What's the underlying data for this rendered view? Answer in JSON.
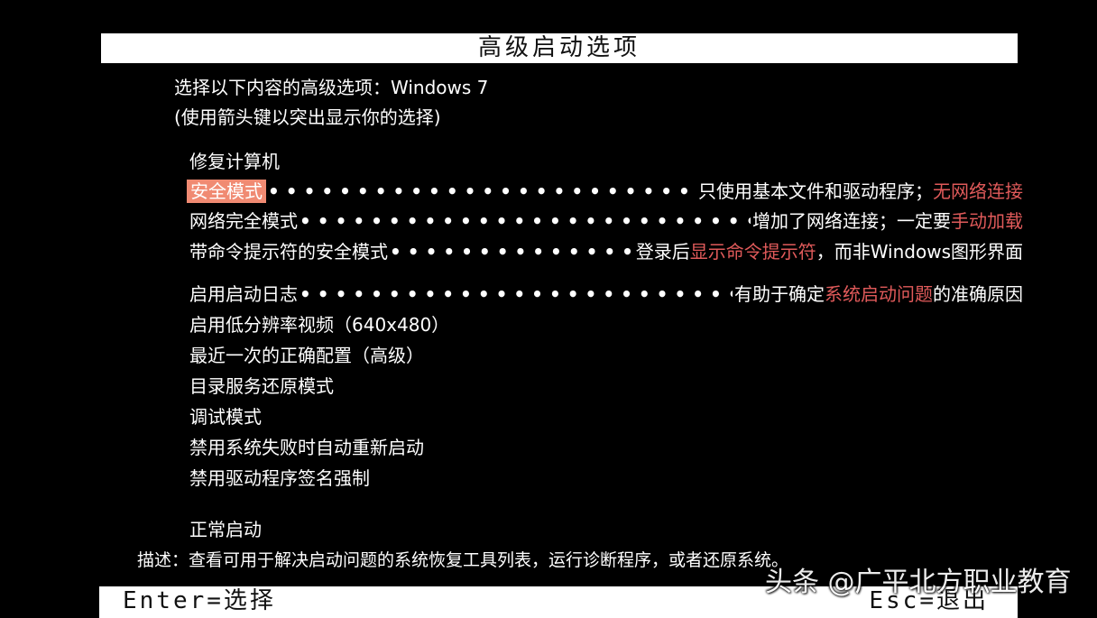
{
  "title": "高级启动选项",
  "prompt": "选择以下内容的高级选项：Windows 7",
  "hint": "(使用箭头键以突出显示你的选择)",
  "options": [
    {
      "label": "修复计算机"
    },
    {
      "label": "安全模式",
      "selected": true,
      "desc_plain": "只使用基本文件和驱动程序；",
      "desc_red": "无网络连接",
      "desc_tail": ""
    },
    {
      "label": "网络完全模式",
      "desc_plain": "增加了网络连接；一定要",
      "desc_red": "手动加载",
      "desc_tail": ""
    },
    {
      "label": "带命令提示符的安全模式",
      "desc_plain": "登录后",
      "desc_red": "显示命令提示符",
      "desc_tail": "，而非Windows图形界面"
    },
    {
      "label": "启用启动日志",
      "desc_plain": "有助于确定",
      "desc_red": "系统启动问题",
      "desc_tail": "的准确原因"
    },
    {
      "label": "启用低分辨率视频（640x480）"
    },
    {
      "label": "最近一次的正确配置（高级）"
    },
    {
      "label": "目录服务还原模式"
    },
    {
      "label": "调试模式"
    },
    {
      "label": "禁用系统失败时自动重新启动"
    },
    {
      "label": "禁用驱动程序签名强制"
    },
    {
      "label": "正常启动"
    }
  ],
  "description": "描述：查看可用于解决启动问题的系统恢复工具列表，运行诊断程序，或者还原系统。",
  "footer": {
    "enter": "Enter=选择",
    "esc": "Esc=退出"
  },
  "watermark": "头条 @广平北方职业教育",
  "colors": {
    "background": "#000000",
    "highlight": "#f08a72",
    "annotation_red": "#e05a5a"
  }
}
